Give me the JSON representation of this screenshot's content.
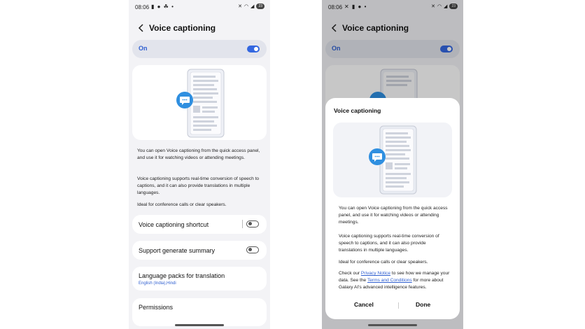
{
  "status_bar": {
    "time": "08:06",
    "battery": "23"
  },
  "header": {
    "title": "Voice captioning"
  },
  "main_toggle": {
    "label": "On",
    "state": "on"
  },
  "description": {
    "p1": "You can open Voice captioning from the quick access panel, and use it for watching videos or attending meetings.",
    "p2": "Voice captioning supports real-time conversion of speech to captions, and it can also provide translations in multiple languages.",
    "p3": "Ideal for conference calls or clear speakers."
  },
  "settings": {
    "shortcut_label": "Voice captioning shortcut",
    "summary_label": "Support generate summary",
    "language_packs_label": "Language packs for translation",
    "language_packs_value": "English (India),Hindi",
    "permissions_label": "Permissions"
  },
  "dialog": {
    "title": "Voice captioning",
    "p1": "You can open Voice captioning from the quick access panel, and use it for watching videos or attending meetings.",
    "p2": "Voice captioning supports real-time conversion of speech to captions, and it can also provide translations in multiple languages.",
    "p3": "Ideal for conference calls or clear speakers.",
    "privacy_prefix": "Check our ",
    "privacy_link": "Privacy Notice",
    "privacy_mid": " to see how we manage your data. See the ",
    "terms_link": "Terms and Conditions",
    "privacy_suffix": " for more about Galaxy AI's advanced intelligence features.",
    "cancel_label": "Cancel",
    "done_label": "Done"
  },
  "colors": {
    "accent": "#3467e0",
    "background": "#f3f3f6",
    "card": "#ffffff"
  }
}
